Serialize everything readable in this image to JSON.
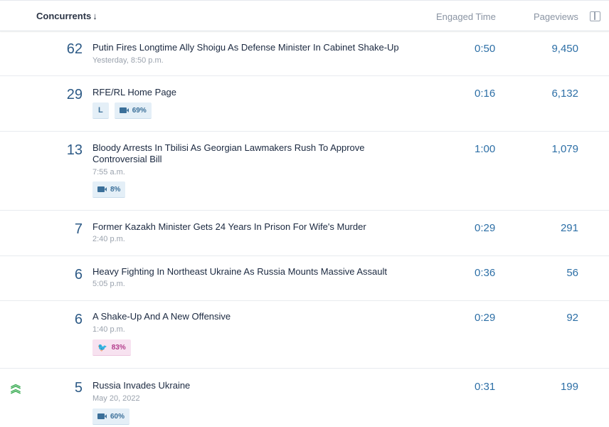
{
  "header": {
    "concurrents_label": "Concurrents",
    "sort_arrow": "↓",
    "engaged_label": "Engaged Time",
    "pageviews_label": "Pageviews"
  },
  "rows": [
    {
      "count": "62",
      "title": "Putin Fires Longtime Ally Shoigu As Defense Minister In Cabinet Shake-Up",
      "time": "Yesterday, 8:50 p.m.",
      "engaged": "0:50",
      "views": "9,450",
      "tags": []
    },
    {
      "count": "29",
      "title": "RFE/RL Home Page",
      "time": "",
      "engaged": "0:16",
      "views": "6,132",
      "tags": [
        {
          "type": "letter",
          "label": "L"
        },
        {
          "type": "video",
          "label": "69%"
        }
      ]
    },
    {
      "count": "13",
      "title": "Bloody Arrests In Tbilisi As Georgian Lawmakers Rush To Approve Controversial Bill",
      "time": "7:55 a.m.",
      "engaged": "1:00",
      "views": "1,079",
      "tags": [
        {
          "type": "video",
          "label": "8%"
        }
      ]
    },
    {
      "count": "7",
      "title": "Former Kazakh Minister Gets 24 Years In Prison For Wife's Murder",
      "time": "2:40 p.m.",
      "engaged": "0:29",
      "views": "291",
      "tags": []
    },
    {
      "count": "6",
      "title": "Heavy Fighting In Northeast Ukraine As Russia Mounts Massive Assault",
      "time": "5:05 p.m.",
      "engaged": "0:36",
      "views": "56",
      "tags": []
    },
    {
      "count": "6",
      "title": "A Shake-Up And A New Offensive",
      "time": "1:40 p.m.",
      "engaged": "0:29",
      "views": "92",
      "tags": [
        {
          "type": "twitter",
          "label": "83%"
        }
      ]
    },
    {
      "count": "5",
      "title": "Russia Invades Ukraine",
      "time": "May 20, 2022",
      "engaged": "0:31",
      "views": "199",
      "tags": [
        {
          "type": "video",
          "label": "60%"
        }
      ],
      "trending": true
    }
  ],
  "icons": {
    "sort": "arrow-down-icon",
    "panel": "panel-toggle-icon",
    "video": "video-camera-icon",
    "twitter": "twitter-bird-icon",
    "trend": "double-chevron-up-icon"
  },
  "colors": {
    "accent": "#2d6fa6",
    "trend": "#33a94d",
    "twitter": "#b33d8c"
  }
}
